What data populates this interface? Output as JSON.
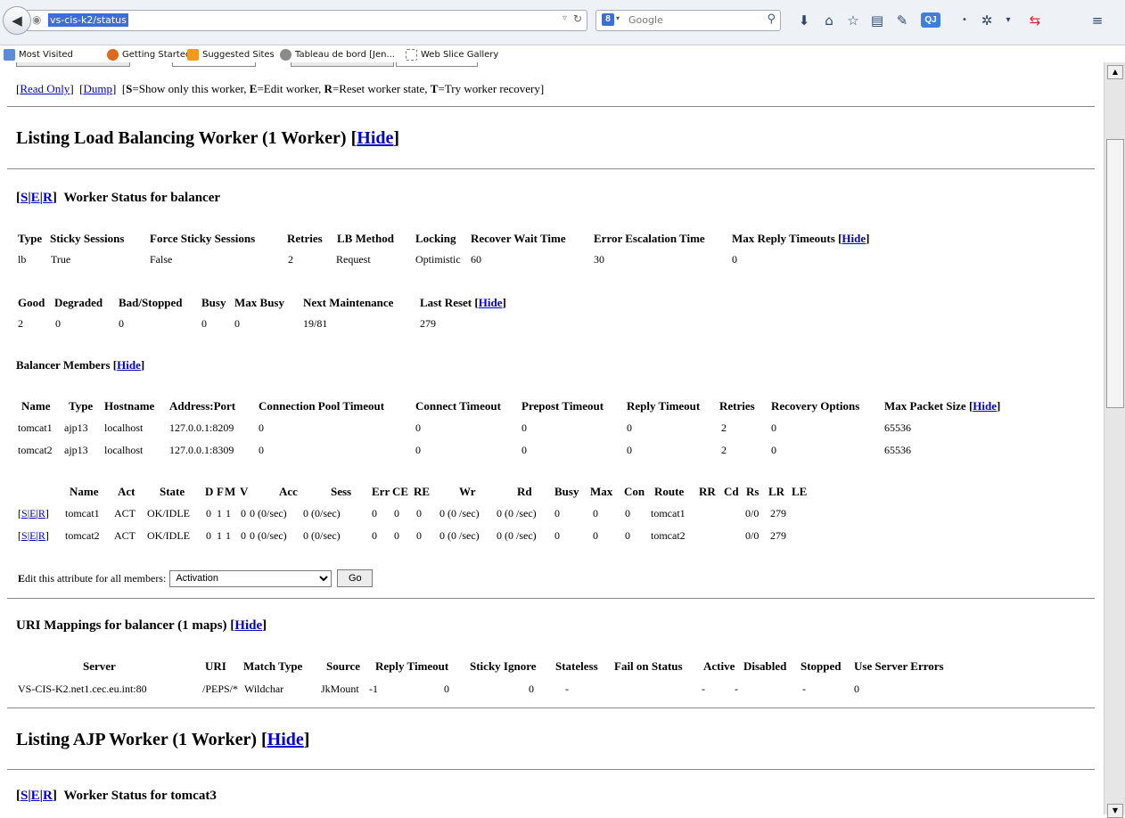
{
  "browser": {
    "url": "vs-cis-k2/status",
    "search_placeholder": "Google",
    "search_engine": "8",
    "addon_badge": "QJ",
    "bookmarks": [
      "Most Visited",
      "Getting Started",
      "Suggested Sites",
      "Tableau de bord [Jen...",
      "Web Slice Gallery"
    ]
  },
  "top_links": {
    "read_only": "Read Only",
    "dump": "Dump",
    "legend_pre": "[",
    "legend": [
      "S",
      "=Show only this worker, ",
      "E",
      "=Edit worker, ",
      "R",
      "=Reset worker state, ",
      "T",
      "=Try worker recovery]"
    ]
  },
  "lb_section": {
    "heading_pre": "Listing Load Balancing Worker (1 Worker) [",
    "hide": "Hide",
    "heading_post": "]",
    "worker_heading": "Worker Status for balancer",
    "ser": [
      "S",
      "E",
      "R"
    ],
    "status_headers": [
      "Type",
      "Sticky Sessions",
      "Force Sticky Sessions",
      "Retries",
      "LB Method",
      "Locking",
      "Recover Wait Time",
      "Error Escalation Time",
      "Max Reply Timeouts"
    ],
    "status_values": [
      "lb",
      "True",
      "False",
      "2",
      "Request",
      "Optimistic",
      "60",
      "30",
      "0"
    ],
    "state_headers": [
      "Good",
      "Degraded",
      "Bad/Stopped",
      "Busy",
      "Max Busy",
      "Next Maintenance",
      "Last Reset"
    ],
    "state_values": [
      "2",
      "0",
      "0",
      "0",
      "0",
      "19/81",
      "279"
    ],
    "balancer_members_label": "Balancer Members",
    "member_headers": [
      "Name",
      "Type",
      "Hostname",
      "Address:Port",
      "Connection Pool Timeout",
      "Connect Timeout",
      "Prepost Timeout",
      "Reply Timeout",
      "Retries",
      "Recovery Options",
      "Max Packet Size"
    ],
    "members": [
      [
        "tomcat1",
        "ajp13",
        "localhost",
        "127.0.0.1:8209",
        "0",
        "0",
        "0",
        "0",
        "2",
        "0",
        "65536"
      ],
      [
        "tomcat2",
        "ajp13",
        "localhost",
        "127.0.0.1:8309",
        "0",
        "0",
        "0",
        "0",
        "2",
        "0",
        "65536"
      ]
    ],
    "runtime_headers": [
      "Name",
      "Act",
      "State",
      "D",
      "F",
      "M",
      "V",
      "Acc",
      "Sess",
      "Err",
      "CE",
      "RE",
      "Wr",
      "Rd",
      "Busy",
      "Max",
      "Con",
      "Route",
      "RR",
      "Cd",
      "Rs",
      "LR",
      "LE"
    ],
    "runtime_rows": [
      [
        "tomcat1",
        "ACT",
        "OK/IDLE",
        "0",
        "1",
        "1",
        "0",
        "0 (0/sec)",
        "0 (0/sec)",
        "0",
        "0",
        "0",
        "0 (0 /sec)",
        "0 (0 /sec)",
        "0",
        "0",
        "0",
        "tomcat1",
        "",
        "",
        "0/0",
        "279",
        ""
      ],
      [
        "tomcat2",
        "ACT",
        "OK/IDLE",
        "0",
        "1",
        "1",
        "0",
        "0 (0/sec)",
        "0 (0/sec)",
        "0",
        "0",
        "0",
        "0 (0 /sec)",
        "0 (0 /sec)",
        "0",
        "0",
        "0",
        "tomcat2",
        "",
        "",
        "0/0",
        "279",
        ""
      ]
    ],
    "edit_label_first": "E",
    "edit_label_rest": "dit this attribute for all members:",
    "edit_select_value": "Activation",
    "go_button": "Go"
  },
  "uri_section": {
    "heading": "URI Mappings for balancer (1 maps) [",
    "hide": "Hide",
    "heading_post": "]",
    "headers": [
      "Server",
      "URI",
      "Match Type",
      "Source",
      "Reply Timeout",
      "Sticky Ignore",
      "Stateless",
      "Fail on Status",
      "Active",
      "Disabled",
      "Stopped",
      "Use Server Errors"
    ],
    "row": [
      "VS-CIS-K2.net1.cec.eu.int:80",
      "/PEPS/*",
      "Wildchar",
      "JkMount",
      "-1",
      "0",
      "0",
      "-",
      "-",
      "-",
      "-",
      "0"
    ]
  },
  "ajp_section": {
    "heading_pre": "Listing AJP Worker (1 Worker) [",
    "hide": "Hide",
    "heading_post": "]",
    "worker_heading": "Worker Status for tomcat3",
    "ser": [
      "S",
      "E",
      "R"
    ]
  }
}
